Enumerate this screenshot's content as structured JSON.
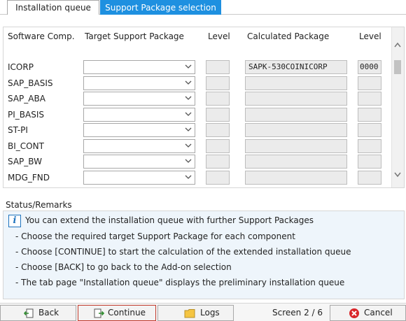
{
  "tabs": [
    {
      "label": "Installation queue"
    },
    {
      "label": "Support Package selection"
    }
  ],
  "table": {
    "headers": {
      "component": "Software Comp.",
      "target": "Target Support Package",
      "level": "Level",
      "calculated": "Calculated Package",
      "level2": "Level"
    },
    "rows": [
      {
        "component": "ICORP",
        "target": "",
        "level": "",
        "calculated": "SAPK-530COINICORP",
        "level2": "0000"
      },
      {
        "component": "SAP_BASIS",
        "target": "",
        "level": "",
        "calculated": "",
        "level2": ""
      },
      {
        "component": "SAP_ABA",
        "target": "",
        "level": "",
        "calculated": "",
        "level2": ""
      },
      {
        "component": "PI_BASIS",
        "target": "",
        "level": "",
        "calculated": "",
        "level2": ""
      },
      {
        "component": "ST-PI",
        "target": "",
        "level": "",
        "calculated": "",
        "level2": ""
      },
      {
        "component": "BI_CONT",
        "target": "",
        "level": "",
        "calculated": "",
        "level2": ""
      },
      {
        "component": "SAP_BW",
        "target": "",
        "level": "",
        "calculated": "",
        "level2": ""
      },
      {
        "component": "MDG_FND",
        "target": "",
        "level": "",
        "calculated": "",
        "level2": ""
      }
    ]
  },
  "status": {
    "title": "Status/Remarks",
    "info_icon": "info-icon",
    "info": "You can extend the installation queue with further Support Packages",
    "bullets": [
      "- Choose the required target Support Package for each component",
      "- Choose [CONTINUE] to start the calculation of the extended installation queue",
      "- Choose [BACK] to go back to the Add-on selection",
      "- The tab page \"Installation queue\" displays the preliminary installation queue"
    ]
  },
  "buttons": {
    "back": "Back",
    "continue": "Continue",
    "logs": "Logs",
    "cancel": "Cancel"
  },
  "screen_indicator": "Screen 2 / 6",
  "colors": {
    "accent": "#1e90e0",
    "cancel_red": "#d9262a",
    "info_blue": "#1e73be"
  }
}
